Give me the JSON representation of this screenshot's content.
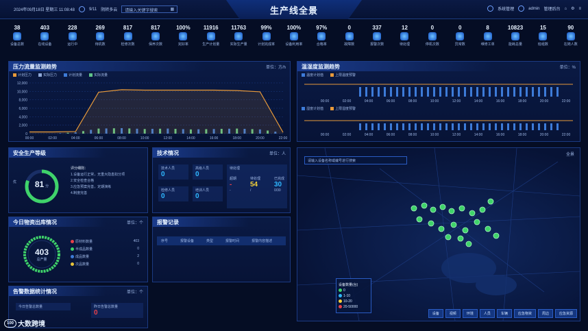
{
  "header": {
    "datetime": "2024年09月18日 星期三 11:08:48",
    "weather": "9/11",
    "weather_desc": "阴转多云",
    "search_text": "请输入关键字搜索",
    "title": "生产线全景",
    "user": "admin",
    "org": "系统管理",
    "right_tag": "管理后台"
  },
  "kpis": [
    {
      "value": "38",
      "label": "设备总数"
    },
    {
      "value": "403",
      "label": "在线设备"
    },
    {
      "value": "228",
      "label": "运行中"
    },
    {
      "value": "269",
      "label": "待机数"
    },
    {
      "value": "817",
      "label": "检修次数"
    },
    {
      "value": "817",
      "label": "保养次数"
    },
    {
      "value": "100%",
      "label": "完好率"
    },
    {
      "value": "11916",
      "label": "生产计划量"
    },
    {
      "value": "11763",
      "label": "实际生产量"
    },
    {
      "value": "99%",
      "label": "计划完成率"
    },
    {
      "value": "100%",
      "label": "设备利用率"
    },
    {
      "value": "97%",
      "label": "合格率"
    },
    {
      "value": "0",
      "label": "故障数"
    },
    {
      "value": "337",
      "label": "报警次数"
    },
    {
      "value": "12",
      "label": "待处理"
    },
    {
      "value": "0",
      "label": "停机次数"
    },
    {
      "value": "0",
      "label": "异常数"
    },
    {
      "value": "8",
      "label": "维修工单"
    },
    {
      "value": "10823",
      "label": "能耗总量"
    },
    {
      "value": "15",
      "label": "班组数"
    },
    {
      "value": "90",
      "label": "在岗人数"
    }
  ],
  "panel_flow": {
    "title": "压力流量监测趋势",
    "unit": "单位：方/h",
    "legend": [
      "计划压力",
      "实际压力",
      "计划流量",
      "实际流量"
    ],
    "chart_data": {
      "type": "line",
      "x": [
        "00:00",
        "02:00",
        "04:00",
        "06:00",
        "08:00",
        "10:00",
        "12:00",
        "14:00",
        "16:00",
        "18:00",
        "20:00",
        "22:00"
      ],
      "ylim": [
        0,
        12000
      ],
      "yticks": [
        "12,000",
        "10,000",
        "8,000",
        "6,000",
        "4,000",
        "2,000",
        "0"
      ],
      "series": [
        {
          "name": "实际压力",
          "values": [
            400,
            400,
            500,
            9800,
            10400,
            10300,
            10300,
            10300,
            10300,
            10200,
            9900,
            300
          ]
        },
        {
          "name": "实际流量",
          "values": [
            0,
            0,
            300,
            1200,
            1300,
            1100,
            1200,
            1000,
            1100,
            1200,
            1000,
            200
          ]
        }
      ]
    }
  },
  "panel_env": {
    "title": "温湿度监测趋势",
    "unit": "单位：%",
    "legend_top": [
      "温度计划值",
      "上限温度预警"
    ],
    "legend_bottom": [
      "湿度计划值",
      "上限湿度预警"
    ],
    "x": [
      "00:00",
      "02:00",
      "04:00",
      "06:00",
      "08:00",
      "10:00",
      "12:00",
      "14:00",
      "16:00",
      "18:00",
      "20:00",
      "22:00"
    ]
  },
  "panel_safety": {
    "title": "安全生产等级",
    "score": "81",
    "score_unit": "分",
    "score_label": "优",
    "rules_title": "评分细则：",
    "rules": [
      "1.设备运行正常，无重大隐患扣分项",
      "2.安全检查合格",
      "3.应急预案完善，定期演练",
      "4.制度完善"
    ]
  },
  "panel_tech": {
    "title": "技术情况",
    "unit": "单位：人",
    "boxes": [
      {
        "label": "技术人员",
        "value": "0"
      },
      {
        "label": "高级人员",
        "value": "0"
      },
      {
        "label": "检修人员",
        "value": "0"
      },
      {
        "label": "培训人员",
        "value": "0"
      }
    ],
    "pending_title": "待处理",
    "pending": [
      {
        "label": "超期",
        "value": "-"
      },
      {
        "label": "待处理",
        "value": "54"
      },
      {
        "label": "已完成",
        "value": "30"
      }
    ],
    "pending_sub": [
      "-",
      "/",
      "0/30"
    ]
  },
  "panel_inventory": {
    "title": "今日物资出库情况",
    "unit": "单位：个",
    "total": "403",
    "total_unit": "总产量",
    "items": [
      {
        "label": "原材料数量",
        "value": "403",
        "color": "#e8414a"
      },
      {
        "label": "半成品数量",
        "value": "0",
        "color": "#3fd36a"
      },
      {
        "label": "成品数量",
        "value": "2",
        "color": "#3d7bd8"
      },
      {
        "label": "次品数量",
        "value": "0",
        "color": "#e8c33a"
      }
    ]
  },
  "panel_alarm": {
    "title": "报警记录",
    "columns": [
      "序号",
      "报警设备",
      "类型",
      "报警时间",
      "报警内容描述"
    ]
  },
  "panel_bottom": {
    "title": "告警数据统计情况",
    "unit": "单位：个",
    "left_label": "今日告警总数量",
    "left_value": "0",
    "right_label": "昨日告警总数量",
    "right_value": "0"
  },
  "map": {
    "search_placeholder": "请输入设备名称或编号进行搜索",
    "legend_title": "设备数量(台)",
    "legend_items": [
      "0",
      "1-10",
      "10-20",
      "20-50000"
    ],
    "buttons": [
      "设备",
      "视频",
      "环境",
      "人员",
      "车辆",
      "应急物资",
      "周边",
      "应急资源"
    ],
    "top_right": "全景"
  },
  "brand": {
    "logo": "100",
    "name": "大数跨境"
  }
}
